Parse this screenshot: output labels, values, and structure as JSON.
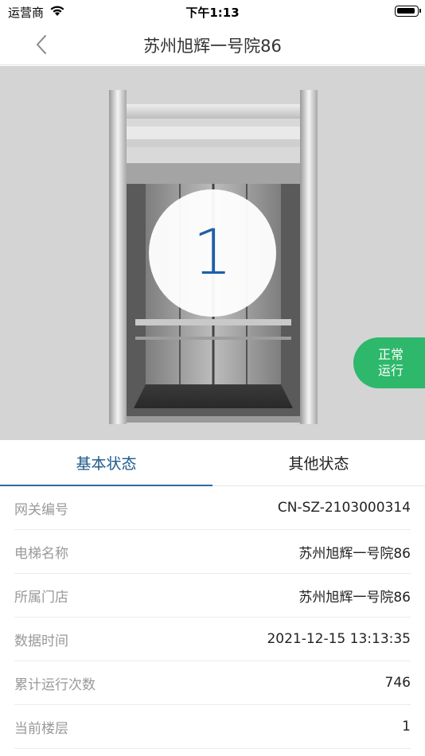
{
  "status_bar": {
    "carrier": "运营商",
    "time": "下午1:13",
    "battery_level": 0.9
  },
  "nav": {
    "title": "苏州旭辉一号院86",
    "back_icon": "chevron-left-icon"
  },
  "elevator": {
    "current_floor": "1",
    "status_line1": "正常",
    "status_line2": "运行",
    "status_color": "#2eb86b",
    "floor_color": "#1f5fa8"
  },
  "tabs": [
    {
      "label": "基本状态",
      "active": true
    },
    {
      "label": "其他状态",
      "active": false
    }
  ],
  "info": [
    {
      "label": "网关编号",
      "value": "CN-SZ-2103000314"
    },
    {
      "label": "电梯名称",
      "value": "苏州旭辉一号院86"
    },
    {
      "label": "所属门店",
      "value": "苏州旭辉一号院86"
    },
    {
      "label": "数据时间",
      "value": "2021-12-15 13:13:35"
    },
    {
      "label": "累计运行次数",
      "value": "746"
    },
    {
      "label": "当前楼层",
      "value": "1"
    }
  ],
  "colors": {
    "accent": "#1f5a8a",
    "tab_underline": "#2d6b9e"
  }
}
